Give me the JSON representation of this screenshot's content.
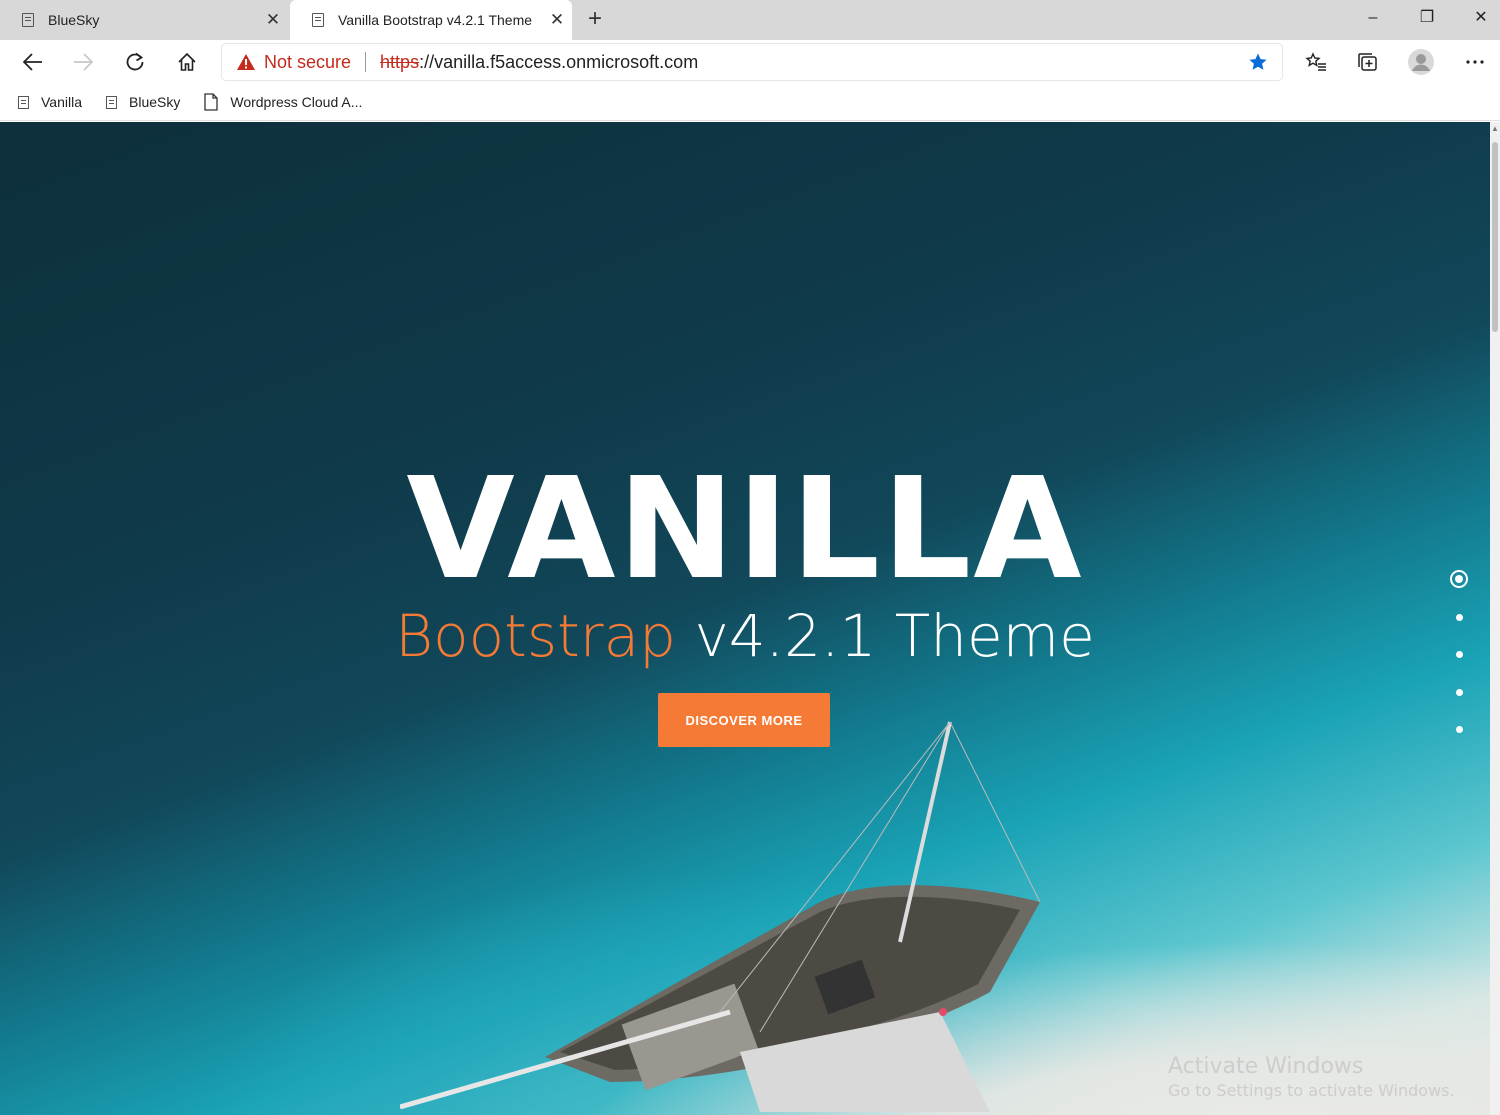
{
  "tabs": [
    {
      "title": "BlueSky",
      "active": false
    },
    {
      "title": "Vanilla Bootstrap v4.2.1 Theme",
      "active": true
    }
  ],
  "window_controls": {
    "minimize": "–",
    "restore": "❐",
    "close": "✕"
  },
  "address_bar": {
    "security_label": "Not secure",
    "scheme": "https",
    "url_rest": "://vanilla.f5access.onmicrosoft.com"
  },
  "bookmarks": [
    {
      "label": "Vanilla",
      "icon": "page-icon"
    },
    {
      "label": "BlueSky",
      "icon": "page-icon"
    },
    {
      "label": "Wordpress Cloud A...",
      "icon": "document-icon"
    }
  ],
  "hero": {
    "title": "VANILLA",
    "subtitle_accent": "Bootstrap",
    "subtitle_rest": "v4.2.1 Theme",
    "cta_label": "DISCOVER MORE"
  },
  "pagination": {
    "count": 5,
    "active_index": 0
  },
  "watermark": {
    "title": "Activate Windows",
    "subtitle": "Go to Settings to activate Windows."
  },
  "colors": {
    "accent": "#f47a35",
    "warning_red": "#c42b1c",
    "favorite_star": "#0a6cd8"
  }
}
